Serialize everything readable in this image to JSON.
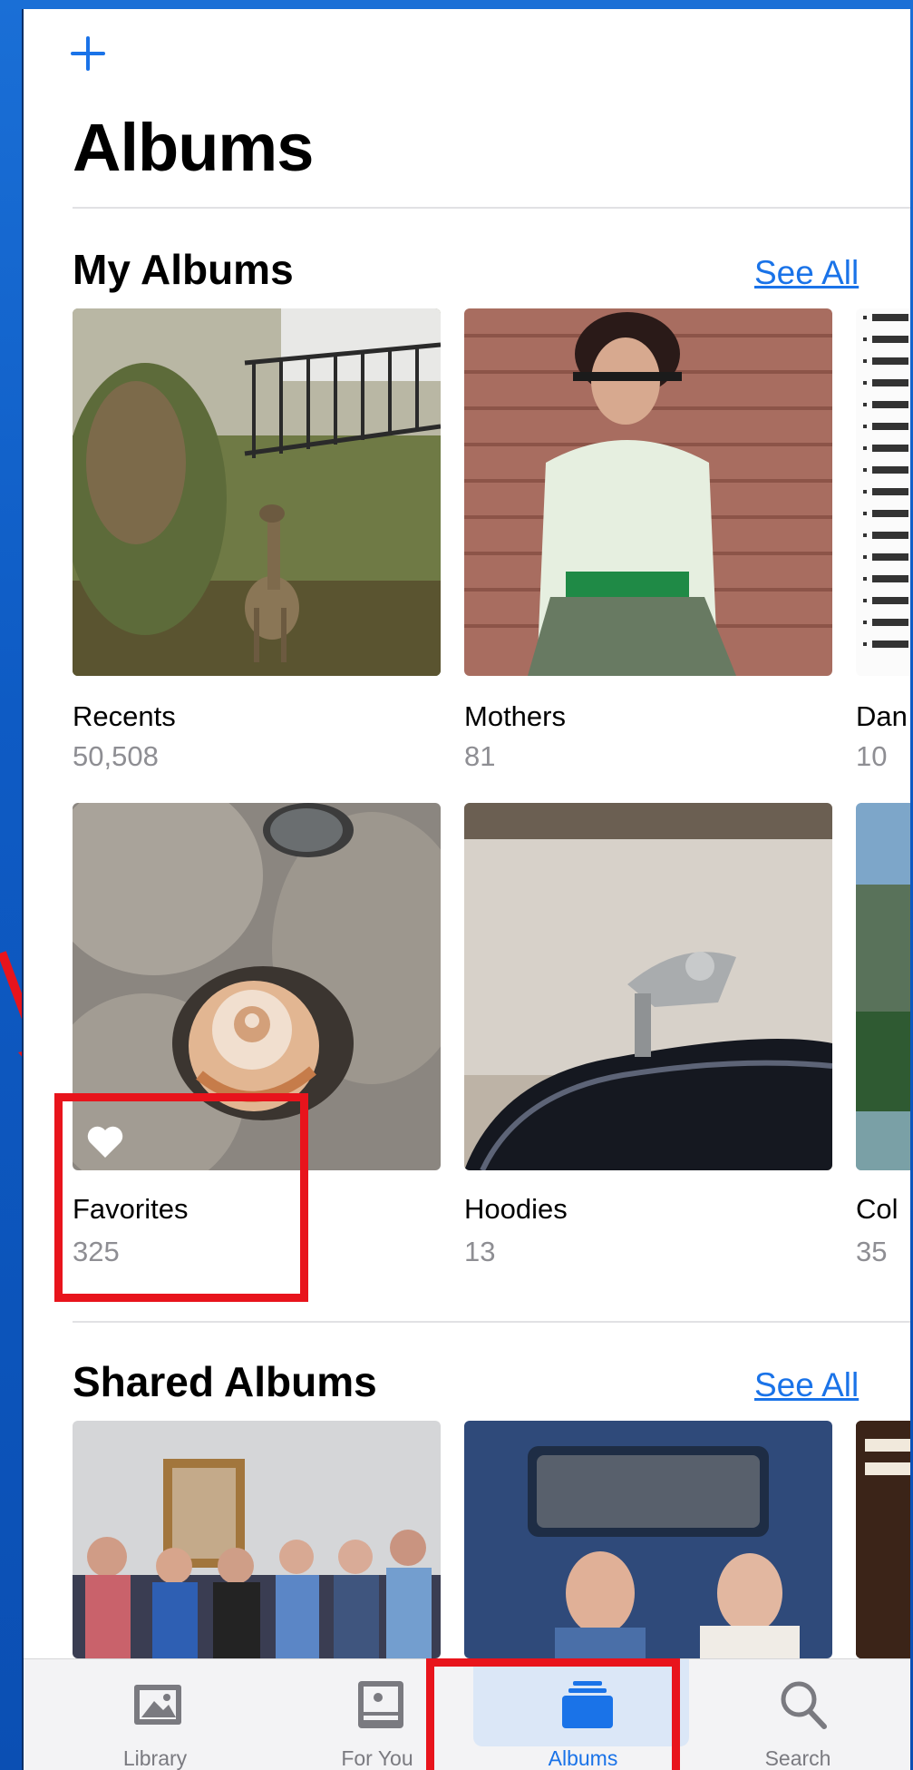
{
  "header": {
    "add_label": "+",
    "title": "Albums"
  },
  "my_albums": {
    "title": "My Albums",
    "see_all": "See All",
    "items": [
      {
        "name": "Recents",
        "count": "50,508"
      },
      {
        "name": "Mothers",
        "count": "81"
      },
      {
        "name": "Dan",
        "count": "10"
      },
      {
        "name": "Favorites",
        "count": "325"
      },
      {
        "name": "Hoodies",
        "count": "13"
      },
      {
        "name": "Col",
        "count": "35"
      }
    ]
  },
  "shared_albums": {
    "title": "Shared Albums",
    "see_all": "See All"
  },
  "tabs": [
    {
      "label": "Library",
      "icon": "photo-icon"
    },
    {
      "label": "For You",
      "icon": "for-you-icon"
    },
    {
      "label": "Albums",
      "icon": "albums-icon",
      "active": true
    },
    {
      "label": "Search",
      "icon": "search-icon"
    }
  ],
  "colors": {
    "accent": "#1a73e8",
    "highlight": "#e8141c",
    "background": "#1a6fd6"
  }
}
